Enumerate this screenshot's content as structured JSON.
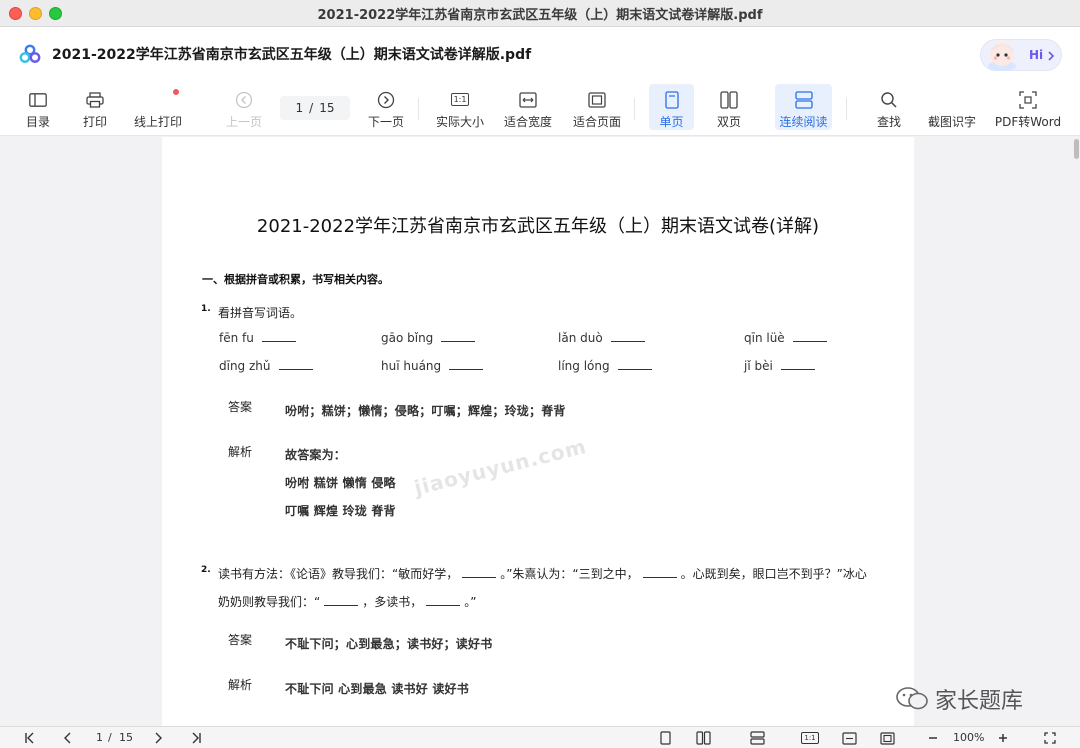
{
  "window": {
    "title": "2021-2022学年江苏省南京市玄武区五年级（上）期末语文试卷详解版.pdf"
  },
  "header": {
    "doc_title": "2021-2022学年江苏省南京市玄武区五年级（上）期末语文试卷详解版.pdf",
    "assistant_label": "Hi"
  },
  "toolbar": {
    "toc": "目录",
    "print": "打印",
    "online_print": "线上打印",
    "prev_page": "上一页",
    "page_current": "1",
    "page_sep": "/",
    "page_total": "15",
    "next_page": "下一页",
    "actual_size": "实际大小",
    "fit_width": "适合宽度",
    "fit_page": "适合页面",
    "single_page": "单页",
    "double_page": "双页",
    "continuous": "连续阅读",
    "find": "查找",
    "ocr": "截图识字",
    "pdf_to_word": "PDF转Word",
    "actual_size_icon_text": "1:1"
  },
  "document": {
    "title": "2021-2022学年江苏省南京市玄武区五年级（上）期末语文试卷(详解)",
    "section1": "一、根据拼音或积累，书写相关内容。",
    "q1": {
      "num": "1.",
      "text": "看拼音写词语。",
      "pinyin": [
        "fēn fu",
        "gāo bǐng",
        "lǎn duò",
        "qīn lüè",
        "dīng zhǔ",
        "huī huáng",
        "líng lóng",
        "jǐ  bèi"
      ],
      "answer_label": "答案",
      "answer": "吩咐；糕饼；懒惰；侵略；叮嘱；辉煌；玲珑；脊背",
      "analysis_label": "解析",
      "analysis_lines": [
        "故答案为：",
        "吩咐 糕饼 懒惰 侵略",
        "叮嘱 辉煌 玲珑 脊背"
      ]
    },
    "q2": {
      "num": "2.",
      "line1_a": "读书有方法：《论语》教导我们：“敏而好学，",
      "line1_b": "。”朱熹认为：“三到之中，",
      "line1_c": "。心既到矣，眼口岂不到乎？”冰心",
      "line2_a": "奶奶则教导我们：“",
      "line2_b": "，多读书，",
      "line2_c": "。”",
      "answer_label": "答案",
      "answer": "不耻下问；心到最急；读书好；读好书",
      "analysis_label": "解析",
      "analysis": "不耻下问 心到最急 读书好 读好书"
    },
    "watermark": "jiaoyuyun.com"
  },
  "brand": {
    "text": "家长题库"
  },
  "bottombar": {
    "page_current": "1",
    "page_sep": "/",
    "page_total": "15",
    "zoom": "100%",
    "actual_size_icon_text": "1:1"
  }
}
